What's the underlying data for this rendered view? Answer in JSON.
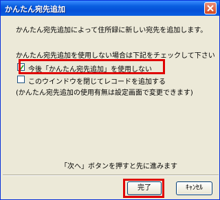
{
  "window": {
    "title": "かんたん宛先追加"
  },
  "body": {
    "intro": "かんたん宛先追加によって住所録に新しい宛先を追加します。",
    "prompt": "かんたん宛先追加を使用しない場合は下記をチェックして下さい",
    "options": [
      {
        "label": "今後「かんたん宛先追加」を使用しない",
        "checked": true
      },
      {
        "label": "このウインドウを閉じてレコードを追加する",
        "checked": false
      }
    ],
    "note": "(かんたん宛先追加の使用有無は設定画面で変更できます)",
    "hint": "「次へ」ボタンを押すと先に進みます"
  },
  "buttons": {
    "finish": "完了",
    "cancel": "ｷｬﾝｾﾙ"
  },
  "colors": {
    "highlight": "#e00000",
    "titlebar": "#0a5fe0",
    "face": "#ece9d8"
  }
}
